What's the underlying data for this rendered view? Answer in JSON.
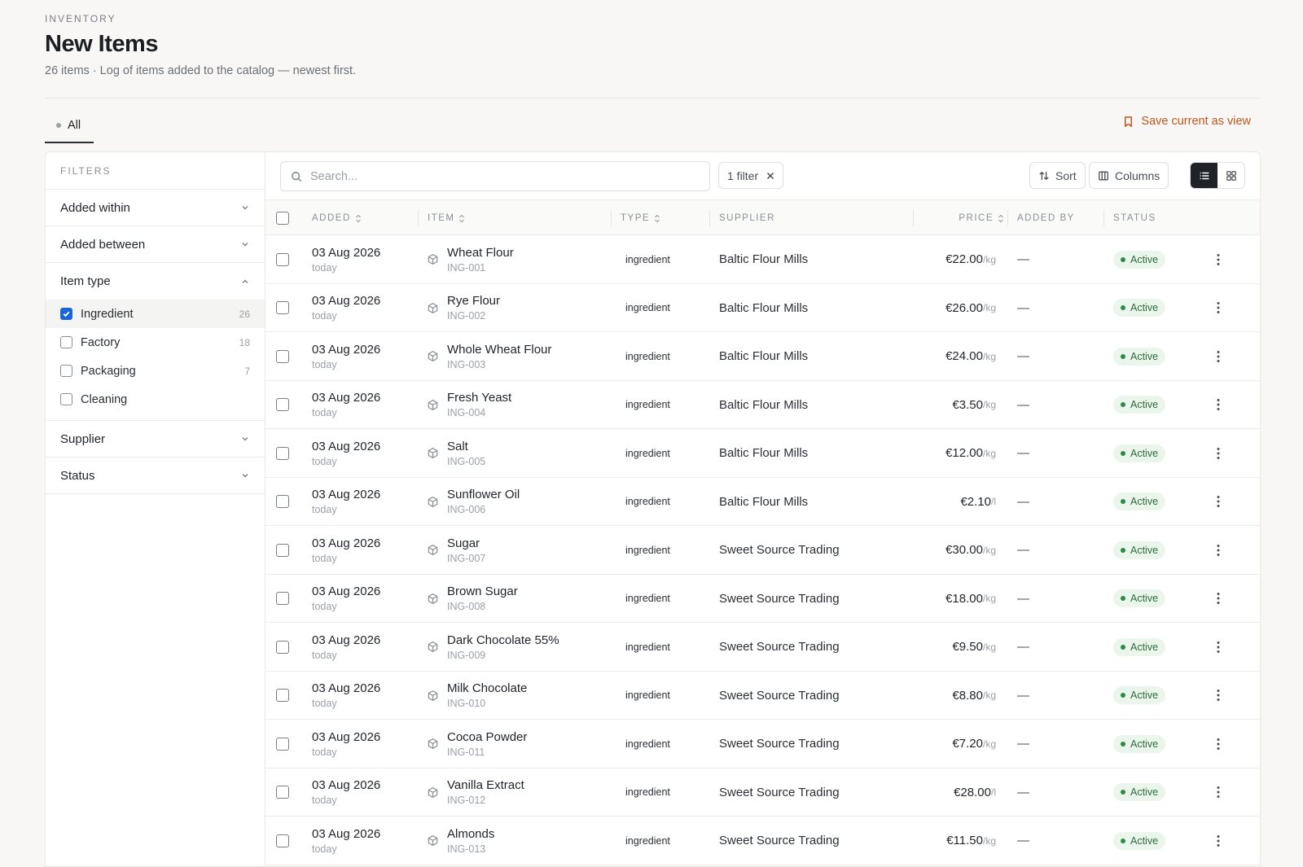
{
  "header": {
    "eyebrow": "INVENTORY",
    "title": "New Items",
    "subtitle": "26 items · Log of items added to the catalog — newest first."
  },
  "tabs": [
    {
      "label": "All"
    }
  ],
  "save_view_label": "Save current as view",
  "filters": {
    "heading": "FILTERS",
    "sections": {
      "added_within": "Added within",
      "added_between": "Added between",
      "item_type": "Item type",
      "supplier": "Supplier",
      "status": "Status"
    },
    "item_type_options": [
      {
        "label": "Ingredient",
        "count": "26",
        "checked": true
      },
      {
        "label": "Factory",
        "count": "18",
        "checked": false
      },
      {
        "label": "Packaging",
        "count": "7",
        "checked": false
      },
      {
        "label": "Cleaning",
        "count": "",
        "checked": false
      }
    ]
  },
  "toolbar": {
    "search_placeholder": "Search...",
    "filter_chip": "1 filter",
    "sort_label": "Sort",
    "columns_label": "Columns"
  },
  "table": {
    "columns": {
      "added": "Added",
      "item": "Item",
      "type": "Type",
      "supplier": "SUPPLIER",
      "price": "Price",
      "added_by": "ADDED BY",
      "status": "STATUS"
    },
    "rows": [
      {
        "date": "03 Aug 2026",
        "rel": "today",
        "name": "Wheat Flour",
        "code": "ING-001",
        "type": "ingredient",
        "supplier": "Baltic Flour Mills",
        "price": "€22.00",
        "unit": "/kg",
        "added_by": "—",
        "status": "Active"
      },
      {
        "date": "03 Aug 2026",
        "rel": "today",
        "name": "Rye Flour",
        "code": "ING-002",
        "type": "ingredient",
        "supplier": "Baltic Flour Mills",
        "price": "€26.00",
        "unit": "/kg",
        "added_by": "—",
        "status": "Active"
      },
      {
        "date": "03 Aug 2026",
        "rel": "today",
        "name": "Whole Wheat Flour",
        "code": "ING-003",
        "type": "ingredient",
        "supplier": "Baltic Flour Mills",
        "price": "€24.00",
        "unit": "/kg",
        "added_by": "—",
        "status": "Active"
      },
      {
        "date": "03 Aug 2026",
        "rel": "today",
        "name": "Fresh Yeast",
        "code": "ING-004",
        "type": "ingredient",
        "supplier": "Baltic Flour Mills",
        "price": "€3.50",
        "unit": "/kg",
        "added_by": "—",
        "status": "Active"
      },
      {
        "date": "03 Aug 2026",
        "rel": "today",
        "name": "Salt",
        "code": "ING-005",
        "type": "ingredient",
        "supplier": "Baltic Flour Mills",
        "price": "€12.00",
        "unit": "/kg",
        "added_by": "—",
        "status": "Active"
      },
      {
        "date": "03 Aug 2026",
        "rel": "today",
        "name": "Sunflower Oil",
        "code": "ING-006",
        "type": "ingredient",
        "supplier": "Baltic Flour Mills",
        "price": "€2.10",
        "unit": "/l",
        "added_by": "—",
        "status": "Active"
      },
      {
        "date": "03 Aug 2026",
        "rel": "today",
        "name": "Sugar",
        "code": "ING-007",
        "type": "ingredient",
        "supplier": "Sweet Source Trading",
        "price": "€30.00",
        "unit": "/kg",
        "added_by": "—",
        "status": "Active"
      },
      {
        "date": "03 Aug 2026",
        "rel": "today",
        "name": "Brown Sugar",
        "code": "ING-008",
        "type": "ingredient",
        "supplier": "Sweet Source Trading",
        "price": "€18.00",
        "unit": "/kg",
        "added_by": "—",
        "status": "Active"
      },
      {
        "date": "03 Aug 2026",
        "rel": "today",
        "name": "Dark Chocolate 55%",
        "code": "ING-009",
        "type": "ingredient",
        "supplier": "Sweet Source Trading",
        "price": "€9.50",
        "unit": "/kg",
        "added_by": "—",
        "status": "Active"
      },
      {
        "date": "03 Aug 2026",
        "rel": "today",
        "name": "Milk Chocolate",
        "code": "ING-010",
        "type": "ingredient",
        "supplier": "Sweet Source Trading",
        "price": "€8.80",
        "unit": "/kg",
        "added_by": "—",
        "status": "Active"
      },
      {
        "date": "03 Aug 2026",
        "rel": "today",
        "name": "Cocoa Powder",
        "code": "ING-011",
        "type": "ingredient",
        "supplier": "Sweet Source Trading",
        "price": "€7.20",
        "unit": "/kg",
        "added_by": "—",
        "status": "Active"
      },
      {
        "date": "03 Aug 2026",
        "rel": "today",
        "name": "Vanilla Extract",
        "code": "ING-012",
        "type": "ingredient",
        "supplier": "Sweet Source Trading",
        "price": "€28.00",
        "unit": "/l",
        "added_by": "—",
        "status": "Active"
      },
      {
        "date": "03 Aug 2026",
        "rel": "today",
        "name": "Almonds",
        "code": "ING-013",
        "type": "ingredient",
        "supplier": "Sweet Source Trading",
        "price": "€11.50",
        "unit": "/kg",
        "added_by": "—",
        "status": "Active"
      }
    ]
  },
  "colors": {
    "accent": "#c2561a",
    "checkbox_checked": "#1a66d6",
    "status_active_bg": "#eaf5ec",
    "status_active_fg": "#2f6b3d"
  }
}
